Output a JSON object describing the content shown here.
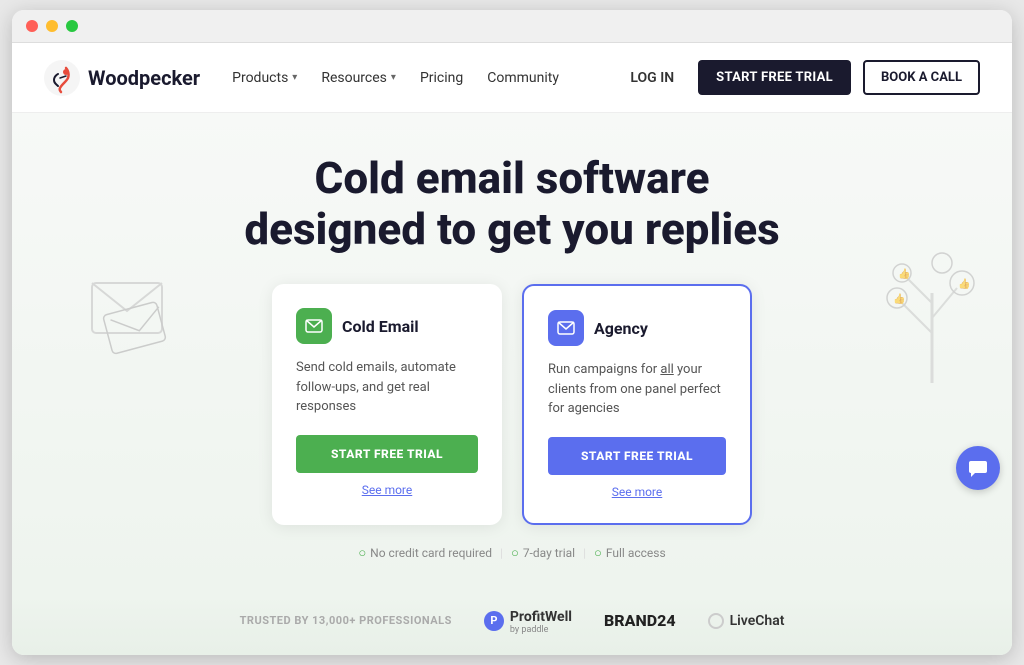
{
  "browser": {
    "dots": [
      "red",
      "yellow",
      "green"
    ]
  },
  "navbar": {
    "logo_text": "Woodpecker",
    "nav_items": [
      {
        "label": "Products",
        "has_dropdown": true
      },
      {
        "label": "Resources",
        "has_dropdown": true
      },
      {
        "label": "Pricing",
        "has_dropdown": false
      },
      {
        "label": "Community",
        "has_dropdown": false
      }
    ],
    "login_label": "LOG IN",
    "start_trial_label": "START FREE TRIAL",
    "book_call_label": "BOOK A CALL"
  },
  "hero": {
    "title_line1": "Cold email software",
    "title_line2": "designed to get you replies"
  },
  "cards": [
    {
      "id": "cold-email",
      "icon_type": "green",
      "title": "Cold Email",
      "description": "Send cold emails, automate follow-ups, and get real responses",
      "cta_label": "START FREE TRIAL",
      "see_more_label": "See more",
      "highlight_word": ""
    },
    {
      "id": "agency",
      "icon_type": "blue",
      "title": "Agency",
      "description": "Run campaigns for all your clients from one panel perfect for agencies",
      "cta_label": "START FREE TRIAL",
      "see_more_label": "See more",
      "highlight_word": "all"
    }
  ],
  "trust_items": [
    {
      "label": "No credit card required"
    },
    {
      "label": "7-day trial"
    },
    {
      "label": "Full access"
    }
  ],
  "partners": {
    "trusted_label": "TRUSTED BY 13,000+ PROFESSIONALS",
    "logos": [
      {
        "name": "ProfitWell",
        "sub": "by paddle"
      },
      {
        "name": "BRAND24"
      },
      {
        "name": "LiveChat"
      }
    ]
  },
  "chat": {
    "icon": "💬"
  }
}
